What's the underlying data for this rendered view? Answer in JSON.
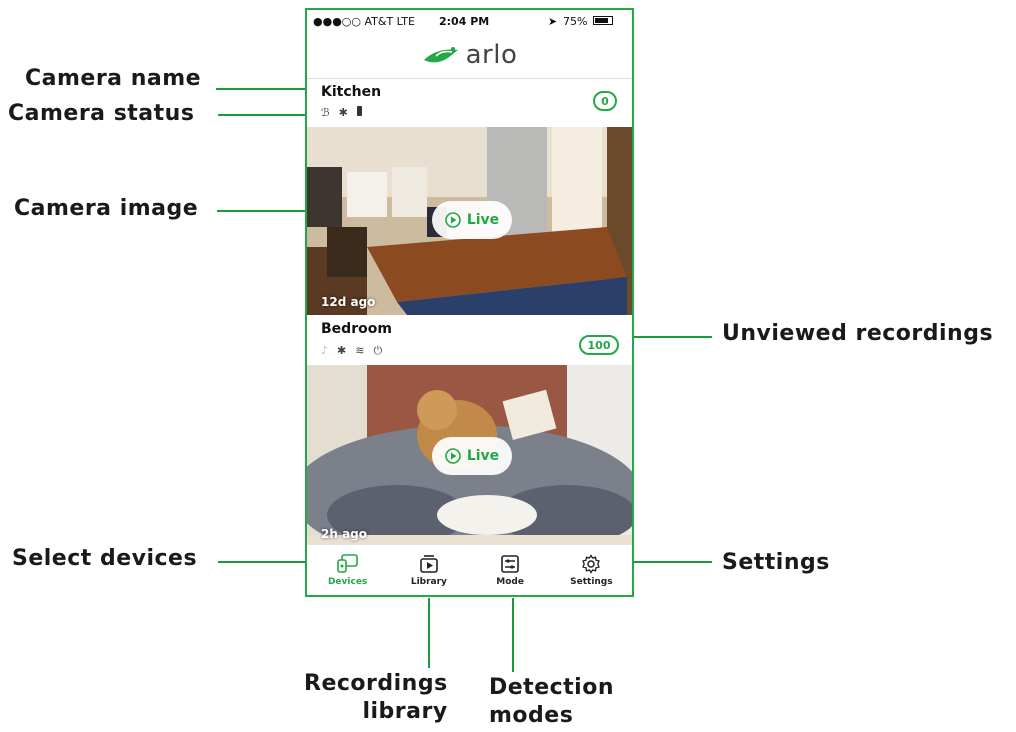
{
  "callouts": {
    "camera_name": "Camera name",
    "camera_status": "Camera status",
    "camera_image": "Camera image",
    "unviewed_recordings": "Unviewed  recordings",
    "select_devices": "Select devices",
    "settings": "Settings",
    "recordings_library_line1": "Recordings",
    "recordings_library_line2": "library",
    "detection_modes_line1": "Detection",
    "detection_modes_line2": "modes"
  },
  "status_bar": {
    "carrier": "●●●○○ AT&T  LTE",
    "time": "2:04 PM",
    "battery": "75%"
  },
  "app": {
    "logo_text": "arlo"
  },
  "cameras": [
    {
      "name": "Kitchen",
      "unviewed_count": "0",
      "last_seen": "12d ago",
      "live_label": "Live",
      "status_icons": [
        "signal-icon",
        "motion-icon",
        "battery-icon"
      ]
    },
    {
      "name": "Bedroom",
      "unviewed_count": "100",
      "last_seen": "2h ago",
      "live_label": "Live",
      "status_icons": [
        "audio-icon",
        "motion-icon",
        "wifi-icon",
        "power-icon"
      ]
    }
  ],
  "tabs": [
    {
      "label": "Devices",
      "icon": "devices-icon",
      "active": true
    },
    {
      "label": "Library",
      "icon": "library-icon",
      "active": false
    },
    {
      "label": "Mode",
      "icon": "mode-icon",
      "active": false
    },
    {
      "label": "Settings",
      "icon": "gear-icon",
      "active": false
    }
  ],
  "colors": {
    "accent": "#22a845"
  }
}
